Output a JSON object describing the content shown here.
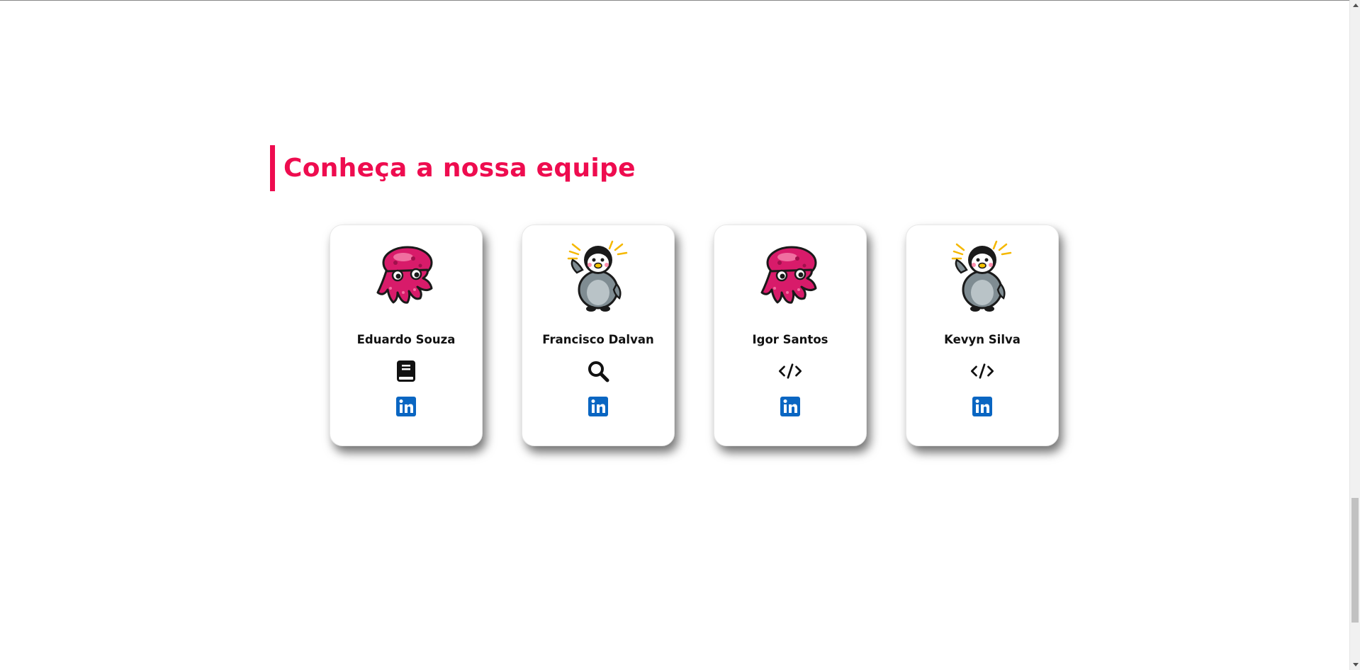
{
  "section": {
    "title": "Conheça a nossa equipe"
  },
  "colors": {
    "accent": "#ee0c4f",
    "linkedin": "#0a66c2"
  },
  "team": [
    {
      "name": "Eduardo Souza",
      "avatar_icon": "octopus-icon",
      "role_icon": "book-icon",
      "link_icon": "linkedin-icon"
    },
    {
      "name": "Francisco Dalvan",
      "avatar_icon": "penguin-icon",
      "role_icon": "search-icon",
      "link_icon": "linkedin-icon"
    },
    {
      "name": "Igor Santos",
      "avatar_icon": "octopus-icon",
      "role_icon": "code-icon",
      "link_icon": "linkedin-icon"
    },
    {
      "name": "Kevyn Silva",
      "avatar_icon": "penguin-icon",
      "role_icon": "code-icon",
      "link_icon": "linkedin-icon"
    }
  ]
}
